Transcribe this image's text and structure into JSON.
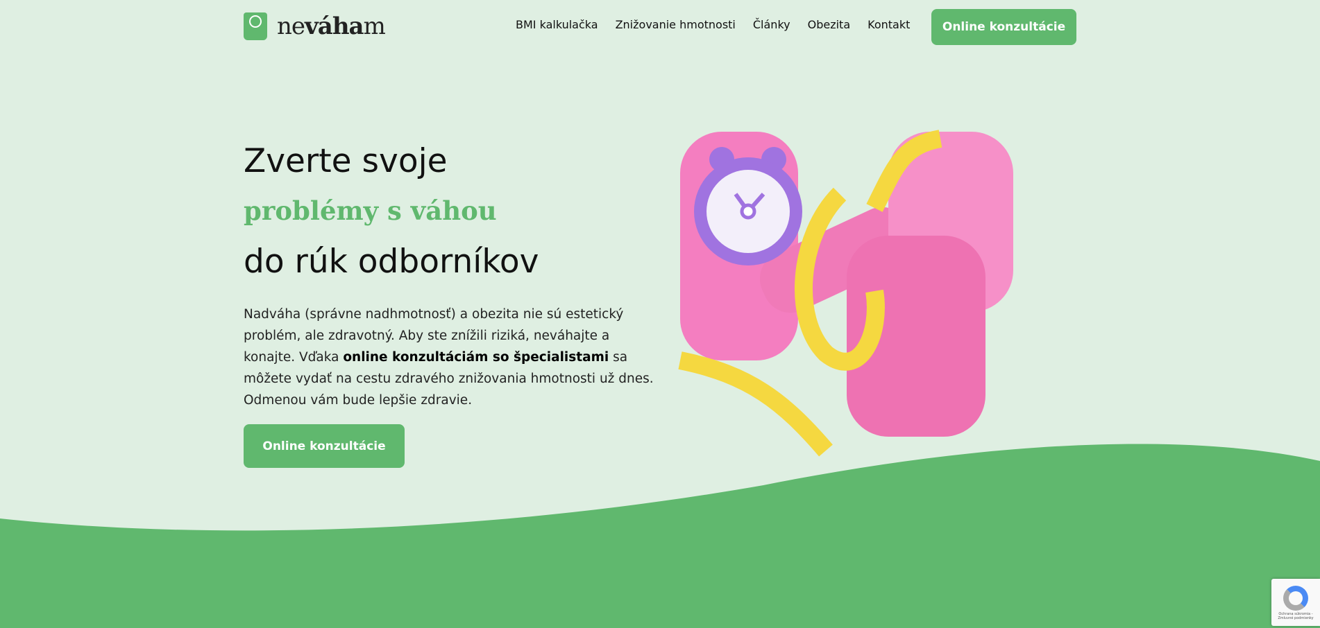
{
  "header": {
    "logo": {
      "prefix": "ne",
      "bold": "váha",
      "suffix": "m"
    },
    "nav": [
      "BMI kalkulačka",
      "Znižovanie hmotnosti",
      "Články",
      "Obezita",
      "Kontakt"
    ],
    "cta": "Online konzultácie"
  },
  "hero": {
    "line1": "Zverte svoje",
    "line2": "problémy s váhou",
    "line3": "do rúk odborníkov",
    "para_before": "Nadváha (správne nadhmotnosť) a obezita nie sú estetický problém, ale zdravotný. Aby ste znížili riziká, neváhajte a konajte. Vďaka ",
    "para_bold": "online konzultáciám so špecialistami",
    "para_after": " sa môžete vydať na cestu zdravého znižovania hmotnosti už dnes. Odmenou vám bude lepšie zdravie.",
    "cta": "Online konzultácie"
  },
  "recaptcha": {
    "text": "Ochrana súkromia - Zmluvné podmienky"
  },
  "colors": {
    "accent": "#60b86e",
    "background": "#dfefe2",
    "pink": "#f47ec0",
    "yellow": "#f5d840",
    "purple": "#a073e0"
  }
}
